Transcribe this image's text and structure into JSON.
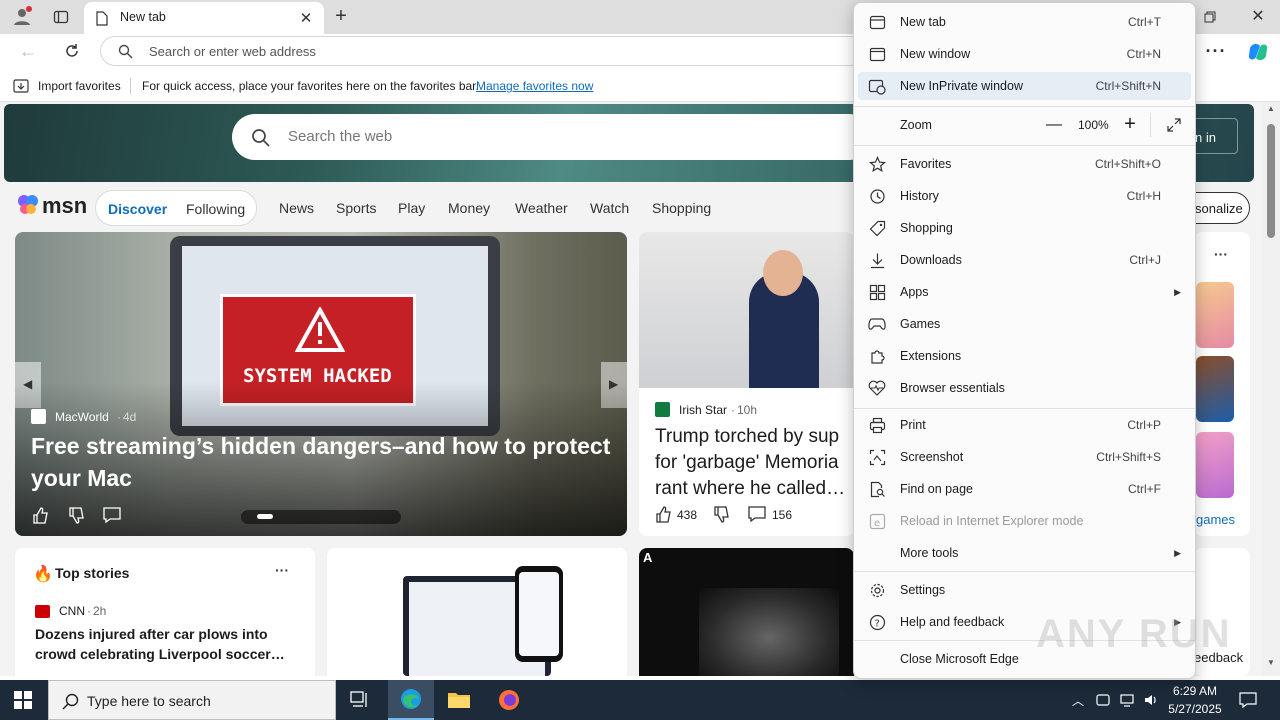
{
  "browser": {
    "tab_title": "New tab",
    "address_placeholder": "Search or enter web address",
    "favorites_bar": {
      "import_label": "Import favorites",
      "hint": "For quick access, place your favorites here on the favorites bar.",
      "manage_link": "Manage favorites now"
    }
  },
  "page": {
    "search_placeholder": "Search the web",
    "sign_in_label": "n in",
    "personalize_label": "sonalize",
    "msn_logo": "msn",
    "feed_tabs": [
      {
        "label": "Discover"
      },
      {
        "label": "Following"
      }
    ],
    "nav_links": [
      "News",
      "Sports",
      "Play",
      "Money",
      "Weather",
      "Watch",
      "Shopping"
    ],
    "main_card": {
      "source": "MacWorld",
      "age": "4d",
      "headline": "Free streaming’s hidden dangers–and how to protect your Mac",
      "image_text": "SYSTEM HACKED"
    },
    "side_card": {
      "source": "Irish Star",
      "age": "10h",
      "headline": "Trump torched by sup for 'garbage' Memoria rant where he called…",
      "likes": "438",
      "comments": "156"
    },
    "top_stories": {
      "title": "Top stories",
      "source": "CNN",
      "age": "2h",
      "headline": "Dozens injured after car plows into crowd celebrating Liverpool soccer…"
    },
    "games_link": "games",
    "feedback_label": "eedback",
    "image_corner_letter": "A"
  },
  "menu": {
    "items": [
      {
        "label": "New tab",
        "shortcut": "Ctrl+T",
        "icon": "new-tab-icon"
      },
      {
        "label": "New window",
        "shortcut": "Ctrl+N",
        "icon": "new-window-icon"
      },
      {
        "label": "New InPrivate window",
        "shortcut": "Ctrl+Shift+N",
        "icon": "inprivate-icon"
      },
      {
        "label": "Zoom",
        "value": "100%"
      },
      {
        "label": "Favorites",
        "shortcut": "Ctrl+Shift+O",
        "icon": "star-icon"
      },
      {
        "label": "History",
        "shortcut": "Ctrl+H",
        "icon": "history-icon"
      },
      {
        "label": "Shopping",
        "shortcut": "",
        "icon": "tag-icon"
      },
      {
        "label": "Downloads",
        "shortcut": "Ctrl+J",
        "icon": "download-icon"
      },
      {
        "label": "Apps",
        "shortcut": "",
        "icon": "apps-icon"
      },
      {
        "label": "Games",
        "shortcut": "",
        "icon": "gamepad-icon"
      },
      {
        "label": "Extensions",
        "shortcut": "",
        "icon": "puzzle-icon"
      },
      {
        "label": "Browser essentials",
        "shortcut": "",
        "icon": "heart-pulse-icon"
      },
      {
        "label": "Print",
        "shortcut": "Ctrl+P",
        "icon": "printer-icon"
      },
      {
        "label": "Screenshot",
        "shortcut": "Ctrl+Shift+S",
        "icon": "screenshot-icon"
      },
      {
        "label": "Find on page",
        "shortcut": "Ctrl+F",
        "icon": "find-icon"
      },
      {
        "label": "Reload in Internet Explorer mode",
        "shortcut": "",
        "icon": "ie-icon"
      },
      {
        "label": "More tools",
        "shortcut": ""
      },
      {
        "label": "Settings",
        "shortcut": "",
        "icon": "gear-icon"
      },
      {
        "label": "Help and feedback",
        "shortcut": "",
        "icon": "help-icon"
      },
      {
        "label": "Close Microsoft Edge",
        "shortcut": ""
      }
    ]
  },
  "taskbar": {
    "search_placeholder": "Type here to search",
    "time": "6:29 AM",
    "date": "5/27/2025"
  },
  "watermark": "ANY RUN",
  "colors": {
    "accent": "#0f6cbd",
    "menu_highlight": "#e5edf5",
    "taskbar": "#1c2a3a"
  }
}
